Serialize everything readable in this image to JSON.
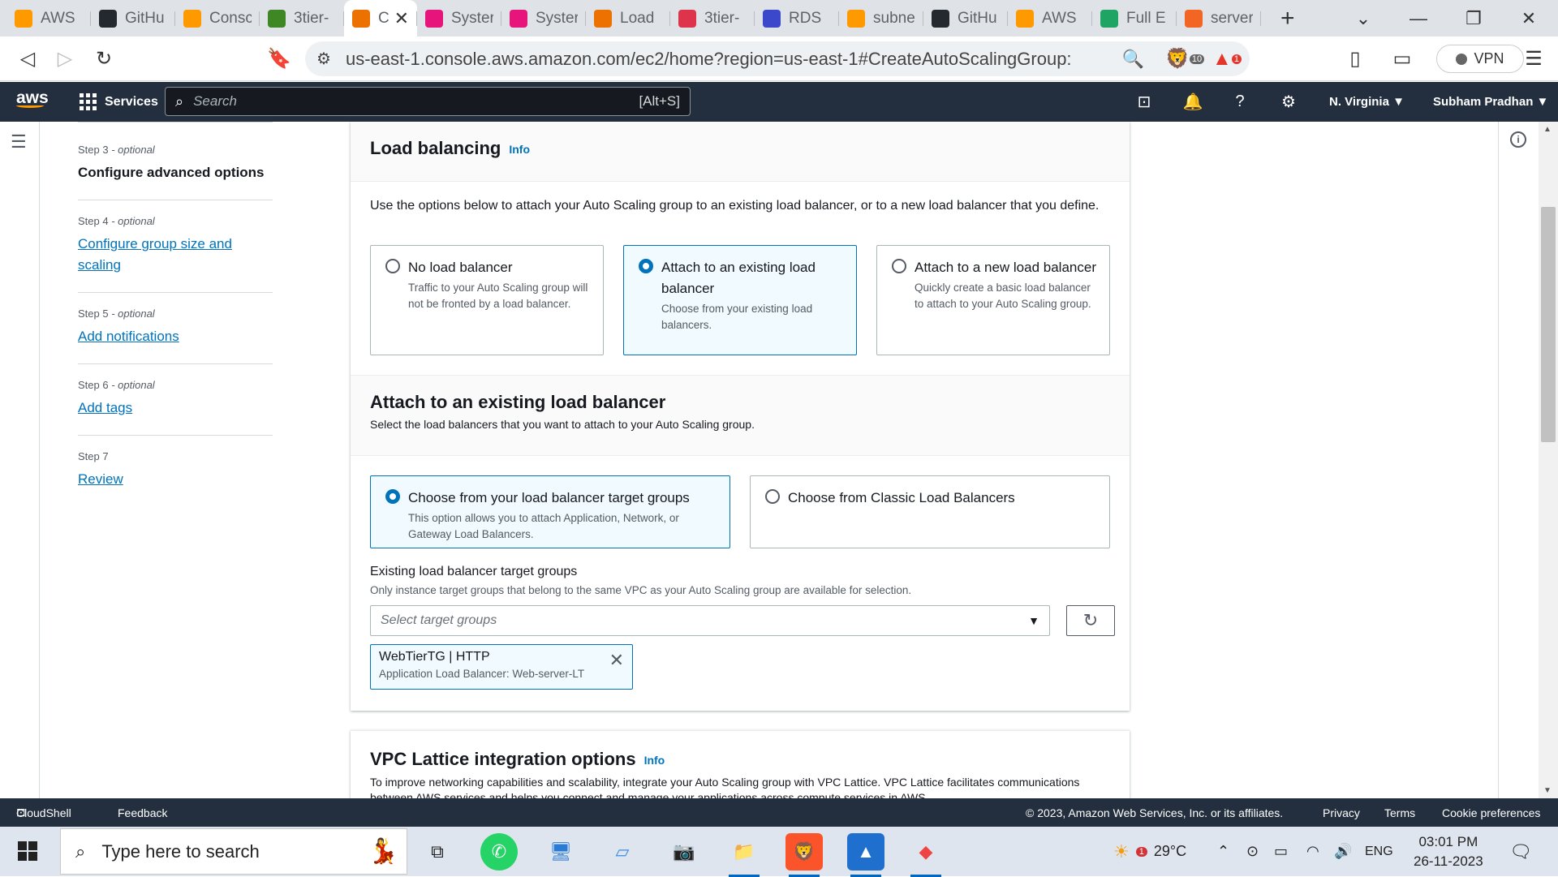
{
  "browser": {
    "tabs": [
      {
        "title": "AWS",
        "color": "#ff9900",
        "icon": "aws-cube-icon"
      },
      {
        "title": "GitHu",
        "color": "#24292f",
        "icon": "github-icon"
      },
      {
        "title": "Consc",
        "color": "#ff9900",
        "icon": "aws-cube-icon"
      },
      {
        "title": "3tier-",
        "color": "#3f8624",
        "icon": "aws-service-icon"
      },
      {
        "title": "C",
        "color": "#ed7100",
        "icon": "ec2-icon",
        "active": true
      },
      {
        "title": "Syster",
        "color": "#e7157b",
        "icon": "systems-manager-icon"
      },
      {
        "title": "Syster",
        "color": "#e7157b",
        "icon": "systems-manager-icon"
      },
      {
        "title": "Load",
        "color": "#ed7100",
        "icon": "ec2-icon"
      },
      {
        "title": "3tier-",
        "color": "#dd344c",
        "icon": "aws-service-icon"
      },
      {
        "title": "RDS",
        "color": "#3b48cc",
        "icon": "rds-icon"
      },
      {
        "title": "subne",
        "color": "#ff9900",
        "icon": "aws-cube-icon"
      },
      {
        "title": "GitHu",
        "color": "#24292f",
        "icon": "github-icon"
      },
      {
        "title": "AWS",
        "color": "#ff9900",
        "icon": "aws-cube-icon"
      },
      {
        "title": "Full E",
        "color": "#20a464",
        "icon": "notion-n-icon"
      },
      {
        "title": "server",
        "color": "#f26522",
        "icon": "ask-icon"
      }
    ],
    "url": "us-east-1.console.aws.amazon.com/ec2/home?region=us-east-1#CreateAutoScalingGroup:",
    "brave_badge": "10",
    "alert_badge": "1",
    "vpn_label": "VPN"
  },
  "aws_header": {
    "logo": "aws",
    "services_label": "Services",
    "search_placeholder": "Search",
    "search_shortcut": "[Alt+S]",
    "region": "N. Virginia",
    "user": "Subham Pradhan"
  },
  "steps": [
    {
      "num": "Step 3",
      "opt": " - optional",
      "label": "Configure advanced options",
      "current": true
    },
    {
      "num": "Step 4",
      "opt": " - optional",
      "label": "Configure group size and scaling"
    },
    {
      "num": "Step 5",
      "opt": " - optional",
      "label": "Add notifications"
    },
    {
      "num": "Step 6",
      "opt": " - optional",
      "label": "Add tags"
    },
    {
      "num": "Step 7",
      "opt": "",
      "label": "Review"
    }
  ],
  "load_balancing": {
    "title": "Load balancing",
    "info": "Info",
    "description": "Use the options below to attach your Auto Scaling group to an existing load balancer, or to a new load balancer that you define.",
    "options": [
      {
        "title": "No load balancer",
        "desc": "Traffic to your Auto Scaling group will not be fronted by a load balancer."
      },
      {
        "title": "Attach to an existing load balancer",
        "desc": "Choose from your existing load balancers."
      },
      {
        "title": "Attach to a new load balancer",
        "desc": "Quickly create a basic load balancer to attach to your Auto Scaling group."
      }
    ],
    "selected_option": 1
  },
  "existing_lb": {
    "title": "Attach to an existing load balancer",
    "description": "Select the load balancers that you want to attach to your Auto Scaling group.",
    "options": [
      {
        "title": "Choose from your load balancer target groups",
        "desc": "This option allows you to attach Application, Network, or Gateway Load Balancers."
      },
      {
        "title": "Choose from Classic Load Balancers",
        "desc": ""
      }
    ],
    "selected_option": 0,
    "tg_label": "Existing load balancer target groups",
    "tg_hint": "Only instance target groups that belong to the same VPC as your Auto Scaling group are available for selection.",
    "tg_placeholder": "Select target groups",
    "token_title": "WebTierTG | HTTP",
    "token_sub": "Application Load Balancer: Web-server-LT"
  },
  "vpc_lattice": {
    "title": "VPC Lattice integration options",
    "info": "Info",
    "description": "To improve networking capabilities and scalability, integrate your Auto Scaling group with VPC Lattice. VPC Lattice facilitates communications between AWS services and helps you connect and manage your applications across compute services in AWS."
  },
  "footer": {
    "cloudshell": "CloudShell",
    "feedback": "Feedback",
    "copyright": "© 2023, Amazon Web Services, Inc. or its affiliates.",
    "privacy": "Privacy",
    "terms": "Terms",
    "cookie": "Cookie preferences"
  },
  "taskbar": {
    "search_placeholder": "Type here to search",
    "temperature": "29°C",
    "weather_badge": "1",
    "language": "ENG",
    "time": "03:01 PM",
    "date": "26-11-2023"
  }
}
